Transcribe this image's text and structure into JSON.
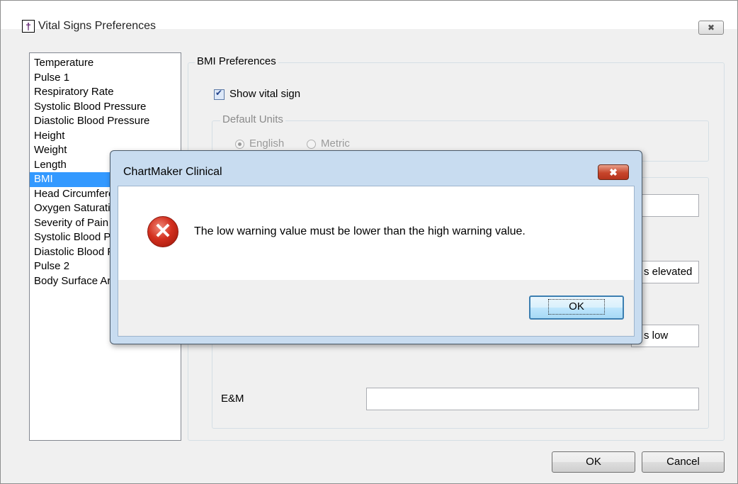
{
  "window": {
    "title": "Vital Signs Preferences",
    "close_icon": "close-icon"
  },
  "vital_signs": [
    "Temperature",
    "Pulse 1",
    "Respiratory Rate",
    "Systolic Blood Pressure",
    "Diastolic Blood Pressure",
    "Height",
    "Weight",
    "Length",
    "BMI",
    "Head Circumference",
    "Oxygen Saturation",
    "Severity of Pain",
    "Systolic Blood Pressure",
    "Diastolic Blood Pressure",
    "Pulse 2",
    "Body Surface Area"
  ],
  "selected_vital": "BMI",
  "prefs": {
    "group_title": "BMI Preferences",
    "show_vital_sign": "Show vital sign",
    "show_vital_sign_checked": true,
    "default_units": "Default Units",
    "unit_english": "English",
    "unit_metric": "Metric",
    "selected_unit": "English",
    "elevated_text": "s elevated",
    "low_text": "s low",
    "em_label": "E&M",
    "em_value": ""
  },
  "buttons": {
    "ok": "OK",
    "cancel": "Cancel"
  },
  "dialog": {
    "title": "ChartMaker Clinical",
    "message": "The low warning value must be lower than the high warning value.",
    "ok": "OK",
    "icon": "error-icon"
  },
  "colors": {
    "selection": "#3399ff",
    "dialog_frame": "#c8dcf0",
    "error_red": "#d3301f"
  }
}
